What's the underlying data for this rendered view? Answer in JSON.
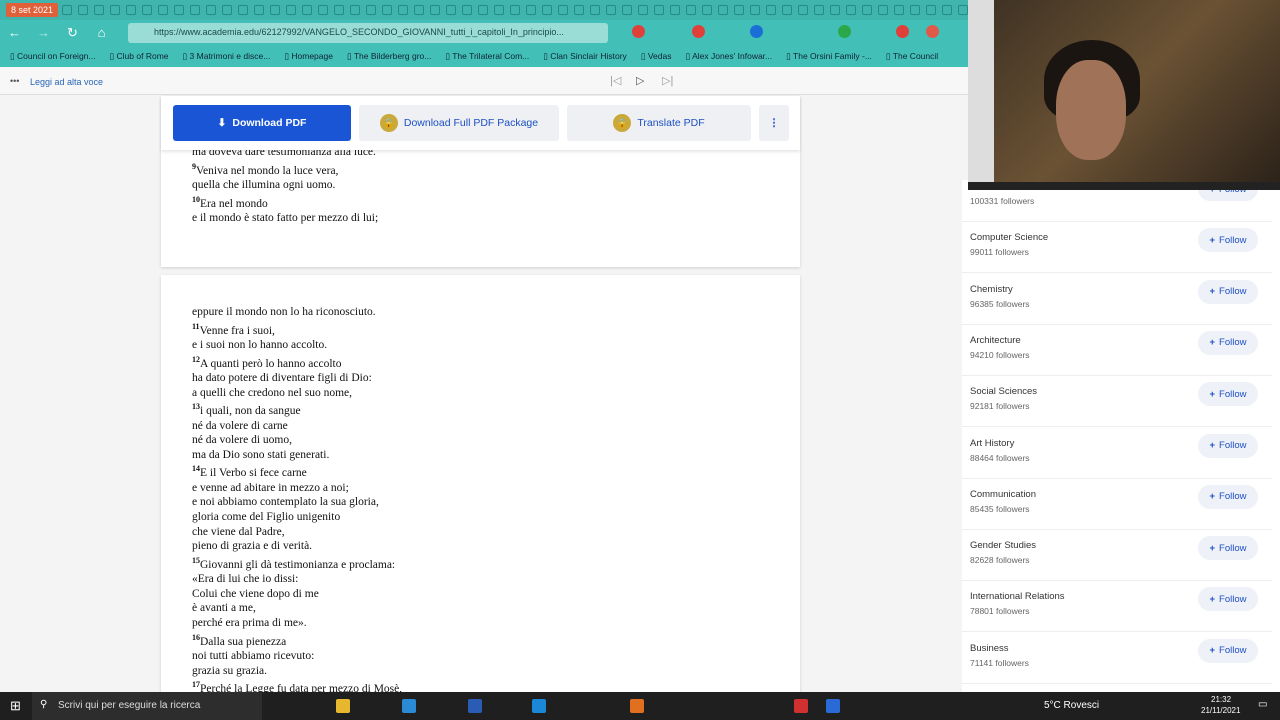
{
  "browser": {
    "tab_date": "8 set 2021",
    "url": "https://www.academia.edu/62127992/VANGELO_SECONDO_GIOVANNI_tutti_i_capitoli_In_principio...",
    "bookmarks": [
      "Council on Foreign...",
      "Club of Rome",
      "3 Matrimoni e disce...",
      "Homepage",
      "The Bilderberg gro...",
      "The Trilateral Com...",
      "Clan Sinclair History",
      "Vedas",
      "Alex Jones' Infowar...",
      "The Orsini Family -...",
      "The Council"
    ],
    "read_aloud": "Leggi ad alta voce"
  },
  "toolbar": {
    "download": "Download PDF",
    "download_full": "Download Full PDF Package",
    "translate": "Translate PDF",
    "more": "⋮"
  },
  "page1_lines": [
    {
      "n": "",
      "t": "ma doveva dare testimonianza alla luce."
    },
    {
      "n": "9",
      "t": "Veniva nel mondo la luce vera,"
    },
    {
      "n": "",
      "t": "quella che illumina ogni uomo."
    },
    {
      "n": "10",
      "t": "Era nel mondo"
    },
    {
      "n": "",
      "t": "e il mondo è stato fatto per mezzo di lui;"
    }
  ],
  "page2_lines": [
    {
      "n": "",
      "t": "eppure il mondo non lo ha riconosciuto."
    },
    {
      "n": "11",
      "t": "Venne fra i suoi,"
    },
    {
      "n": "",
      "t": "e i suoi non lo hanno accolto."
    },
    {
      "n": "12",
      "t": "A quanti però lo hanno accolto"
    },
    {
      "n": "",
      "t": "ha dato potere di diventare figli di Dio:"
    },
    {
      "n": "",
      "t": "a quelli che credono nel suo nome,"
    },
    {
      "n": "13",
      "t": "i quali, non da sangue"
    },
    {
      "n": "",
      "t": "né da volere di carne"
    },
    {
      "n": "",
      "t": "né da volere di uomo,"
    },
    {
      "n": "",
      "t": "ma da Dio sono stati generati."
    },
    {
      "n": "14",
      "t": "E il Verbo si fece carne"
    },
    {
      "n": "",
      "t": "e venne ad abitare in mezzo a noi;"
    },
    {
      "n": "",
      "t": "e noi abbiamo contemplato la sua gloria,"
    },
    {
      "n": "",
      "t": "gloria come del Figlio unigenito"
    },
    {
      "n": "",
      "t": "che viene dal Padre,"
    },
    {
      "n": "",
      "t": "pieno di grazia e di verità."
    },
    {
      "n": "15",
      "t": "Giovanni gli dà testimonianza e proclama:"
    },
    {
      "n": "",
      "t": "«Era di lui che io dissi:"
    },
    {
      "n": "",
      "t": "Colui che viene dopo di me"
    },
    {
      "n": "",
      "t": "è avanti a me,"
    },
    {
      "n": "",
      "t": "perché era prima di me»."
    },
    {
      "n": "16",
      "t": "Dalla sua pienezza"
    },
    {
      "n": "",
      "t": "noi tutti abbiamo ricevuto:"
    },
    {
      "n": "",
      "t": "grazia su grazia."
    },
    {
      "n": "17",
      "t": "Perché la Legge fu data per mezzo di Mosè,"
    }
  ],
  "follow_label": "Follow",
  "topics": [
    {
      "name": "",
      "count": "100331 followers"
    },
    {
      "name": "Computer Science",
      "count": "99011 followers"
    },
    {
      "name": "Chemistry",
      "count": "96385 followers"
    },
    {
      "name": "Architecture",
      "count": "94210 followers"
    },
    {
      "name": "Social Sciences",
      "count": "92181 followers"
    },
    {
      "name": "Art History",
      "count": "88464 followers"
    },
    {
      "name": "Communication",
      "count": "85435 followers"
    },
    {
      "name": "Gender Studies",
      "count": "82628 followers"
    },
    {
      "name": "International Relations",
      "count": "78801 followers"
    },
    {
      "name": "Business",
      "count": "71141 followers"
    }
  ],
  "taskbar": {
    "search_placeholder": "Scrivi qui per eseguire la ricerca",
    "weather": "5°C  Rovesci",
    "time": "21:32",
    "date": "21/11/2021"
  }
}
